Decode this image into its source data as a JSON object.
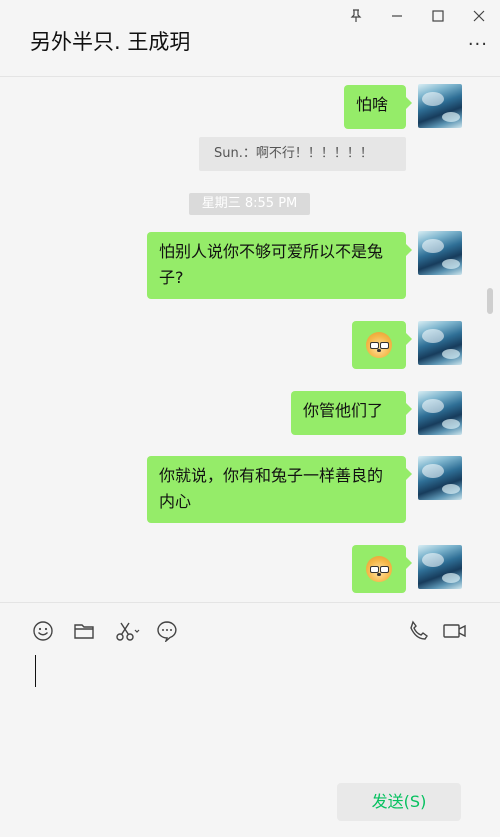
{
  "window": {
    "title": "另外半只. 王成玥",
    "controls": [
      "pin-icon",
      "minimize-icon",
      "maximize-icon",
      "close-icon"
    ],
    "more_label": "···"
  },
  "messages": {
    "m1": "怕啥",
    "quote": "Sun.：啊不行！！！！！！",
    "timestamp": "星期三 8:55 PM",
    "m2": "怕别人说你不够可爱所以不是兔子?",
    "m3_emoji": "doge-emoji",
    "m4": "你管他们了",
    "m5": "你就说，你有和兔子一样善良的内心",
    "m6_emoji": "doge-emoji"
  },
  "toolbar": {
    "icons": [
      "emoji-icon",
      "folder-icon",
      "scissors-icon",
      "chat-bubble-icon",
      "phone-icon",
      "video-icon"
    ]
  },
  "input": {
    "value": ""
  },
  "send_button": {
    "label": "发送(S)"
  },
  "colors": {
    "bubble": "#95ec69",
    "send_text": "#07c160",
    "background": "#f5f5f5"
  }
}
